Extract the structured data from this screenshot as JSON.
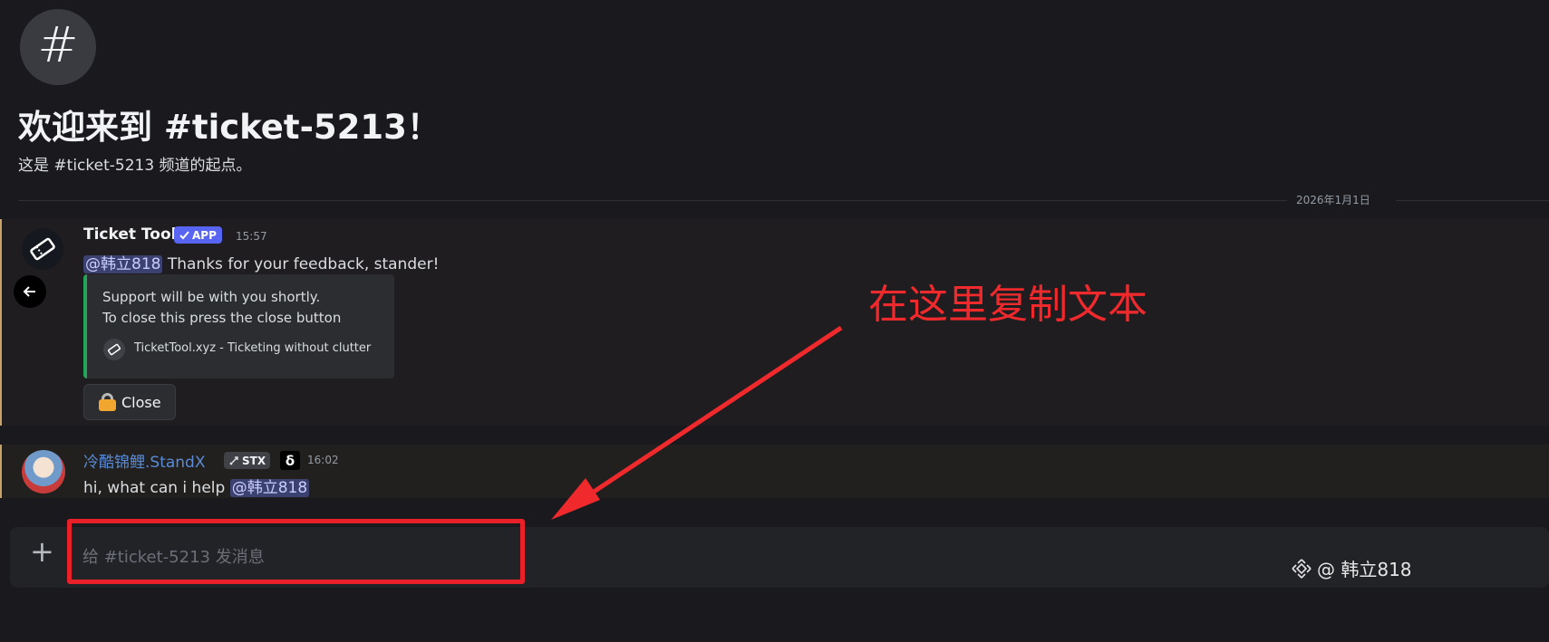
{
  "channel": {
    "icon_glyph": "#",
    "welcome_title": "欢迎来到 #ticket-5213！",
    "welcome_subtitle": "这是 #ticket-5213 频道的起点。"
  },
  "date_divider": "2026年1月1日",
  "messages": [
    {
      "author": "Ticket Tool",
      "badge": "APP",
      "time": "15:57",
      "mention": "@韩立818",
      "text": " Thanks for your feedback, stander!",
      "embed": {
        "line1": "Support will be with you shortly.",
        "line2": "To close this press the close button",
        "footer": "TicketTool.xyz - Ticketing without clutter"
      },
      "button_label": "Close"
    },
    {
      "author": "冷酷锦鲤.StandX",
      "tag": "STX",
      "role_glyph": "δ",
      "time": "16:02",
      "text": "hi, what can i help ",
      "mention": "@韩立818"
    }
  ],
  "composer": {
    "placeholder": "给 #ticket-5213 发消息",
    "plus_glyph": "+"
  },
  "annotation": {
    "text": "在这里复制文本",
    "color": "#f0292c"
  },
  "watermark": "@ 韩立818",
  "colors": {
    "background": "#1a1a1e",
    "app_badge": "#5865f2",
    "embed_accent": "#23a55a",
    "mention_bg": "#3c4270",
    "highlight": "#e8202a"
  }
}
